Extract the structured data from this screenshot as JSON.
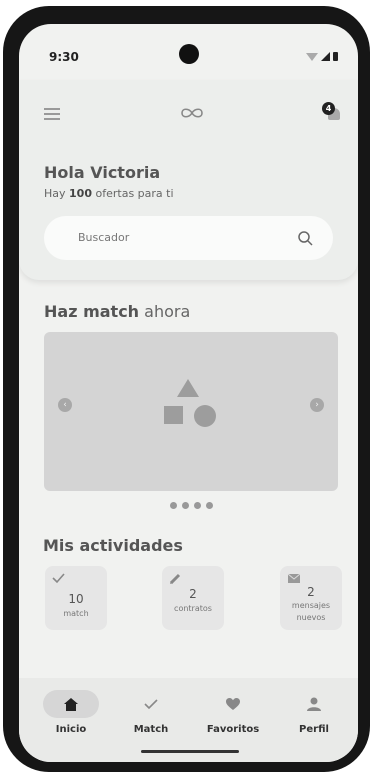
{
  "status_bar": {
    "time": "9:30"
  },
  "header": {
    "notification_count": "4",
    "greeting": "Hola Victoria",
    "subline_prefix": "Hay ",
    "subline_count": "100",
    "subline_suffix": " ofertas para ti",
    "search_placeholder": "Buscador"
  },
  "match_section": {
    "title_bold": "Haz match",
    "title_rest": " ahora"
  },
  "activities": {
    "title": "Mis actividades",
    "items": [
      {
        "icon": "check-icon",
        "number": "10",
        "label": "match"
      },
      {
        "icon": "pencil-icon",
        "number": "2",
        "label": "contratos"
      },
      {
        "icon": "mail-icon",
        "number": "2",
        "label": "mensajes nuevos"
      }
    ]
  },
  "bottom_nav": {
    "items": [
      {
        "icon": "home-icon",
        "label": "Inicio",
        "active": true
      },
      {
        "icon": "check-icon",
        "label": "Match"
      },
      {
        "icon": "heart-icon",
        "label": "Favoritos"
      },
      {
        "icon": "person-icon",
        "label": "Perfil"
      }
    ]
  },
  "colors": {
    "screen_bg": "#f1f2f0",
    "card_bg": "#e6e6e6",
    "frame": "#161616"
  }
}
